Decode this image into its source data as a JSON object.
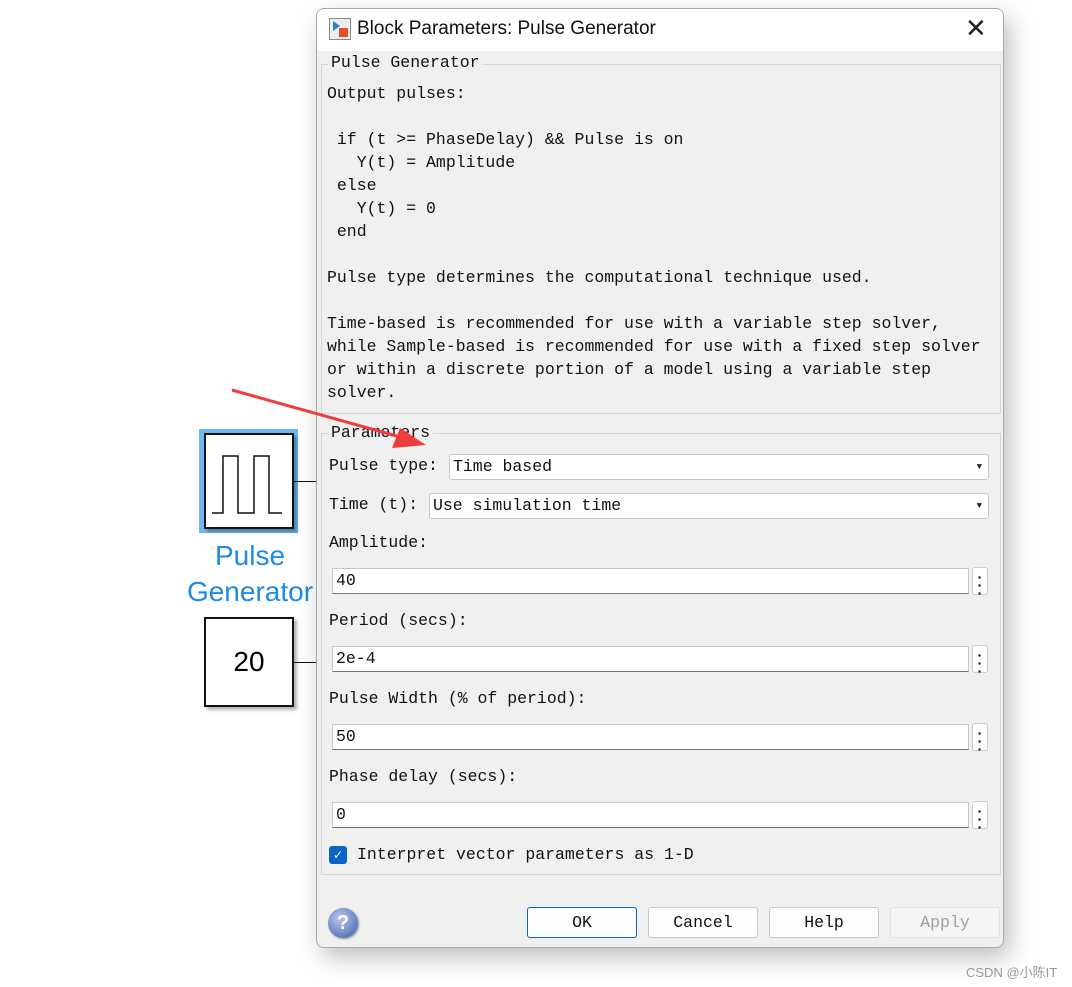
{
  "canvas": {
    "pulse_block_label_line1": "Pulse",
    "pulse_block_label_line2": "Generator",
    "constant_value": "20",
    "label_color": "#1a8ce8"
  },
  "dialog": {
    "title": "Block Parameters: Pulse Generator",
    "description_group": "Pulse Generator",
    "description": "Output pulses:\n\n if (t >= PhaseDelay) && Pulse is on\n   Y(t) = Amplitude\n else\n   Y(t) = 0\n end\n\nPulse type determines the computational technique used.\n\nTime-based is recommended for use with a variable step solver,\nwhile Sample-based is recommended for use with a fixed step solver\nor within a discrete portion of a model using a variable step\nsolver.",
    "parameters_group": "Parameters",
    "pulse_type_label": "Pulse type:",
    "pulse_type_value": "Time based",
    "time_label": "Time (t):",
    "time_value": "Use simulation time",
    "amplitude_label": "Amplitude:",
    "amplitude_value": "40",
    "period_label": "Period (secs):",
    "period_value": "2e-4",
    "pulse_width_label": "Pulse Width (% of period):",
    "pulse_width_value": "50",
    "phase_delay_label": "Phase delay (secs):",
    "phase_delay_value": "0",
    "interpret_label": "Interpret vector parameters as 1-D",
    "interpret_checked": true,
    "buttons": {
      "ok": "OK",
      "cancel": "Cancel",
      "help": "Help",
      "apply": "Apply"
    }
  },
  "watermark": "CSDN @小陈IT",
  "colors": {
    "accent": "#0a64c8",
    "arrow": "#f03c3c"
  }
}
